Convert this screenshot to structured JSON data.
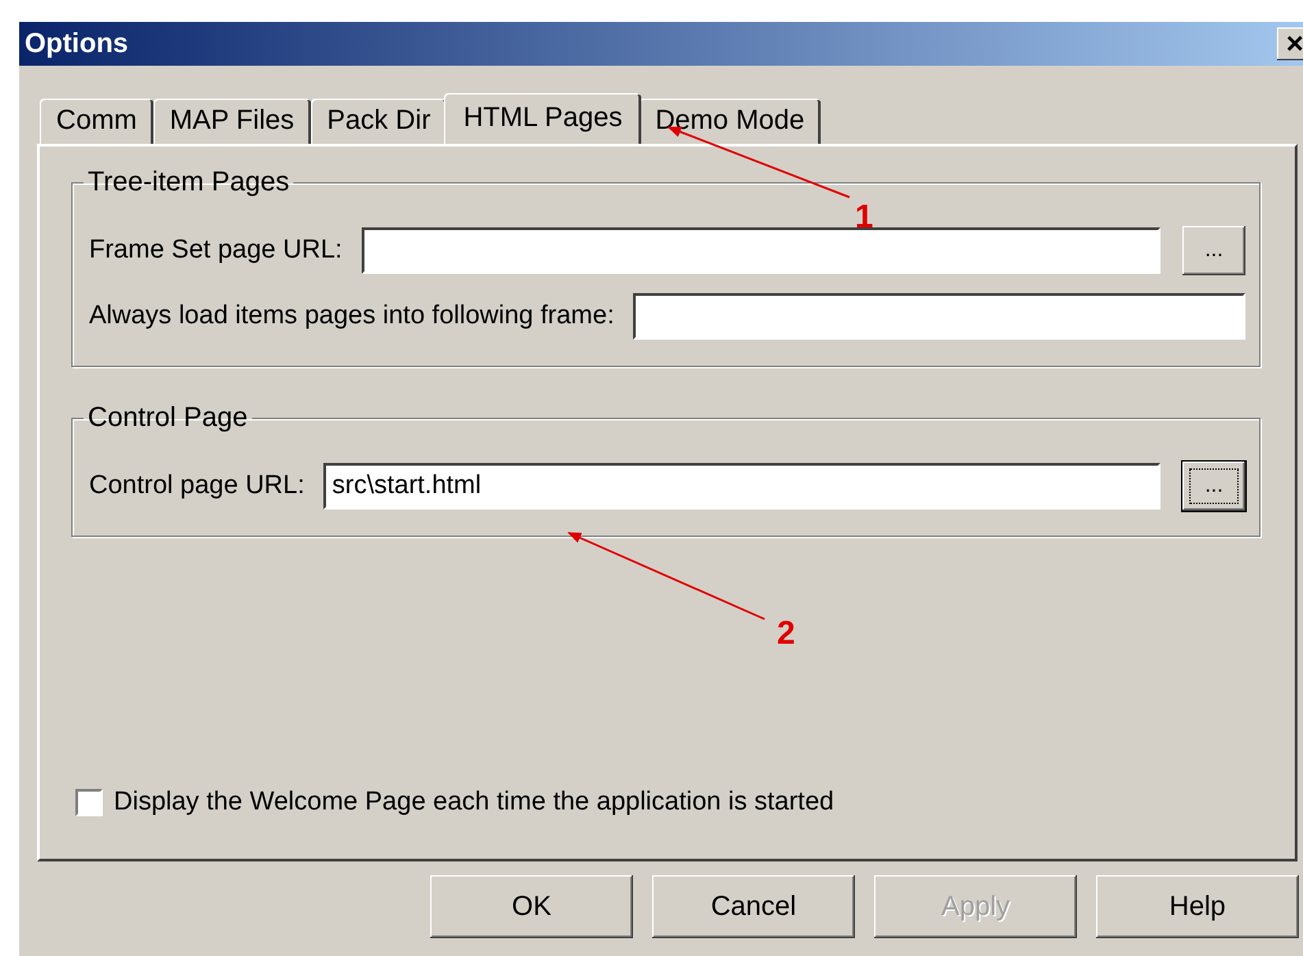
{
  "window": {
    "title": "Options",
    "close": "×"
  },
  "tabs": [
    {
      "label": "Comm",
      "selected": false
    },
    {
      "label": "MAP Files",
      "selected": false
    },
    {
      "label": "Pack Dir",
      "selected": false
    },
    {
      "label": "HTML Pages",
      "selected": true
    },
    {
      "label": "Demo Mode",
      "selected": false
    }
  ],
  "groups": [
    {
      "title": "Tree-item Pages",
      "rows": [
        {
          "label": "Frame Set page URL:",
          "value": "",
          "browse": "...",
          "focused": false
        },
        {
          "label": "Always load items pages into following frame:",
          "value": ""
        }
      ]
    },
    {
      "title": "Control Page",
      "rows": [
        {
          "label": "Control page URL:",
          "value": "src\\start.html",
          "browse": "...",
          "focused": true
        }
      ]
    }
  ],
  "checkbox": {
    "label": "Display the Welcome Page each time the application is started",
    "checked": false
  },
  "buttons": [
    {
      "label": "OK",
      "disabled": false
    },
    {
      "label": "Cancel",
      "disabled": false
    },
    {
      "label": "Apply",
      "disabled": true
    },
    {
      "label": "Help",
      "disabled": false
    }
  ],
  "annotations": [
    {
      "label": "1"
    },
    {
      "label": "2"
    }
  ]
}
